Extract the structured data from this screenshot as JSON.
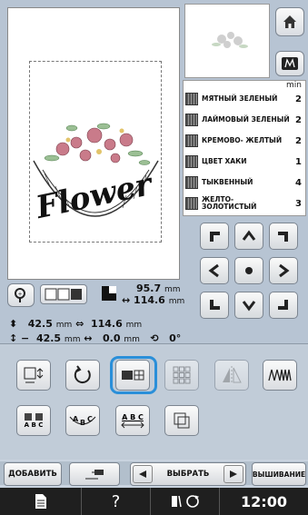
{
  "design": {
    "text": "Flower"
  },
  "colors": {
    "min_label": "min",
    "items": [
      {
        "name": "МЯТНЫЙ ЗЕЛЕНЫЙ",
        "min": "2"
      },
      {
        "name": "ЛАЙМОВЫЙ ЗЕЛЕНЫЙ",
        "min": "2"
      },
      {
        "name": "КРЕМОВО- ЖЕЛТЫЙ",
        "min": "2"
      },
      {
        "name": "ЦВЕТ ХАКИ",
        "min": "1"
      },
      {
        "name": "ТЫКВЕННЫЙ",
        "min": "4"
      },
      {
        "name": "ЖЕЛТО- ЗОЛОТИСТЫЙ",
        "min": "3"
      }
    ]
  },
  "info": {
    "size_height": "95.7",
    "size_width": "114.6",
    "unit": "mm",
    "pos_top": "42.5",
    "pos_width": "114.6",
    "offset_y_sign": "−",
    "offset_y": "42.5",
    "offset_x": "0.0",
    "angle": "0°"
  },
  "tools": {
    "abc_1": "A B C",
    "abc_2": "A B C",
    "abc_3": "A B C"
  },
  "bottom": {
    "add_label": "ДОБАВИТЬ",
    "select_label": "ВЫБРАТЬ",
    "embroider_label": "ВЫШИВАНИЕ"
  },
  "status": {
    "time": "12:00"
  }
}
